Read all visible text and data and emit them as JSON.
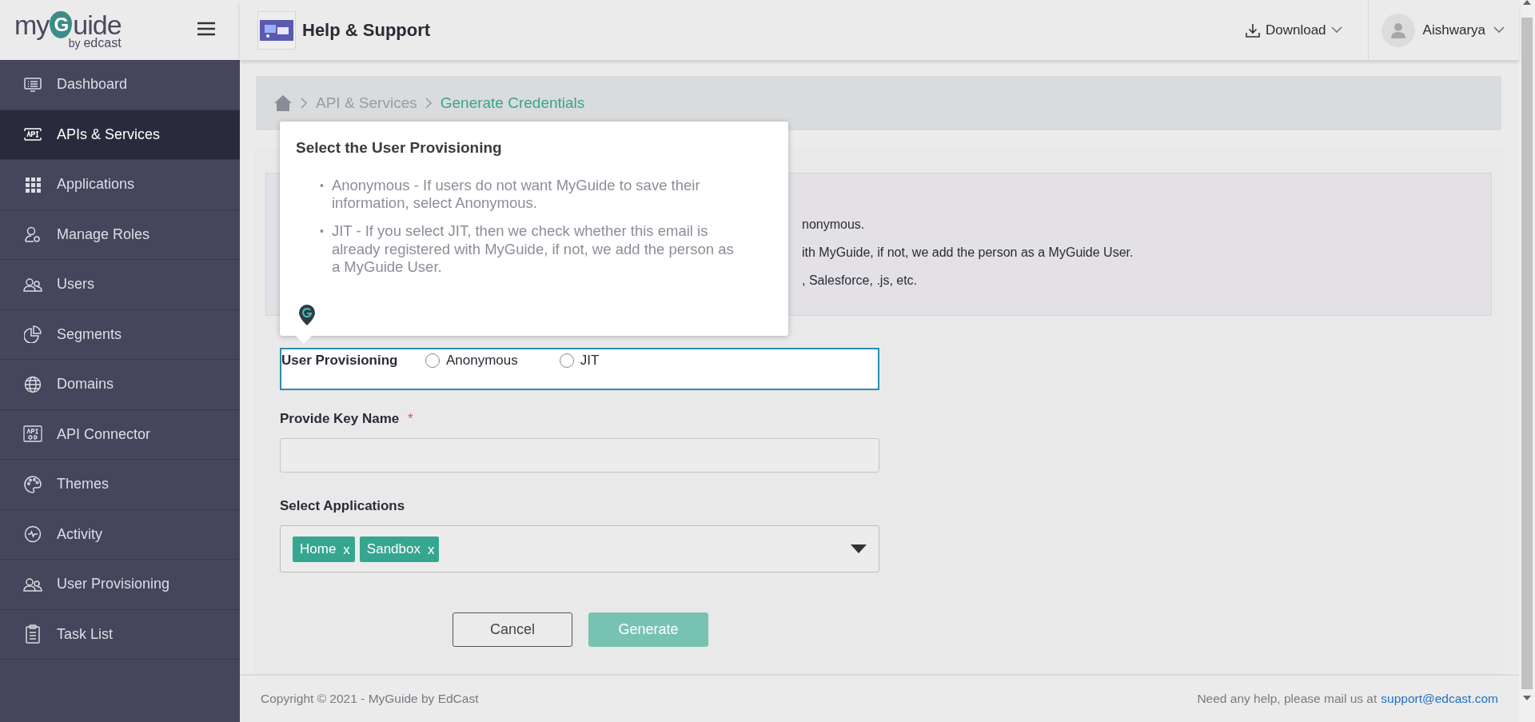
{
  "logo": {
    "brand_start": "my",
    "brand_letter": "G",
    "brand_end": "uide",
    "tagline_by": "by",
    "tagline_name": "edcast"
  },
  "sidebar": {
    "items": [
      {
        "label": "Dashboard",
        "selected": false
      },
      {
        "label": "APIs & Services",
        "selected": true
      },
      {
        "label": "Applications",
        "selected": false
      },
      {
        "label": "Manage Roles",
        "selected": false
      },
      {
        "label": "Users",
        "selected": false
      },
      {
        "label": "Segments",
        "selected": false
      },
      {
        "label": "Domains",
        "selected": false
      },
      {
        "label": "API Connector",
        "selected": false
      },
      {
        "label": "Themes",
        "selected": false
      },
      {
        "label": "Activity",
        "selected": false
      },
      {
        "label": "User Provisioning",
        "selected": false
      },
      {
        "label": "Task List",
        "selected": false
      }
    ]
  },
  "header": {
    "title": "Help & Support",
    "download": "Download",
    "user": "Aishwarya"
  },
  "breadcrumb": [
    {
      "label": "API & Services",
      "current": false
    },
    {
      "label": "Generate Credentials",
      "current": true
    }
  ],
  "info": {
    "lines": [
      "nonymous.",
      "ith MyGuide, if not, we add the person as a MyGuide User.",
      ", Salesforce, .js, etc."
    ]
  },
  "popup": {
    "title": "Select the User Provisioning",
    "marker": "•",
    "bullets": [
      "Anonymous - If users do not want MyGuide to save their information, select Anonymous.",
      "JIT - If you select JIT, then we check whether this email is already registered with MyGuide, if not, we add the person as a MyGuide User."
    ]
  },
  "form": {
    "provisioning": {
      "label": "User Provisioning",
      "options": [
        {
          "label": "Anonymous",
          "selected": false
        },
        {
          "label": "JIT",
          "selected": false
        }
      ]
    },
    "key_name": {
      "label": "Provide Key Name",
      "required": "*"
    },
    "applications": {
      "label": "Select Applications",
      "tags": [
        {
          "label": "Home",
          "remove": "x"
        },
        {
          "label": "Sandbox",
          "remove": "x"
        }
      ]
    },
    "buttons": [
      {
        "label": "Cancel",
        "kind": "secondary",
        "disabled": false
      },
      {
        "label": "Generate",
        "kind": "primary",
        "disabled": true
      }
    ]
  },
  "footer": {
    "copyright": "Copyright © 2021 - MyGuide by EdCast",
    "help": "Need any help, please mail us at",
    "email": "support@edcast.com"
  }
}
